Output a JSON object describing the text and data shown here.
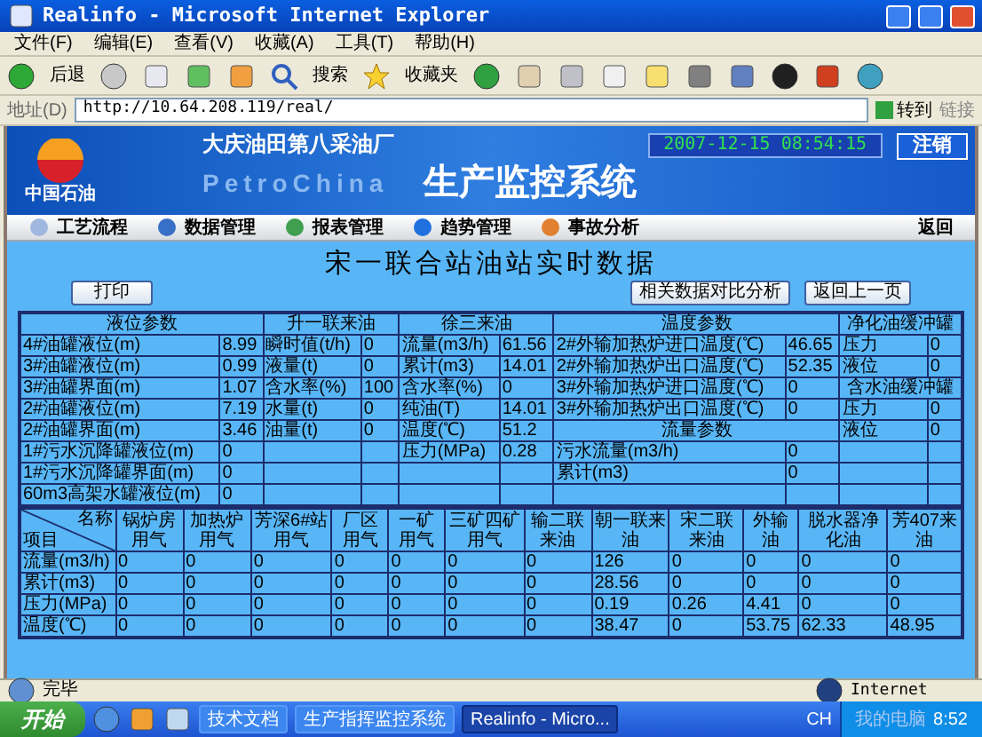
{
  "window": {
    "title": "Realinfo - Microsoft Internet Explorer"
  },
  "menu": [
    "文件(F)",
    "编辑(E)",
    "查看(V)",
    "收藏(A)",
    "工具(T)",
    "帮助(H)"
  ],
  "toolbar": {
    "back": "后退",
    "search": "搜索",
    "favorites": "收藏夹"
  },
  "address": {
    "label": "地址(D)",
    "url": "http://10.64.208.119/real/",
    "go": "转到",
    "links": "链接"
  },
  "banner": {
    "logo_text": "中国石油",
    "company": "大庆油田第八采油厂",
    "brand": "PetroChina",
    "system": "生产监控系统",
    "clock": "2007-12-15 08:54:15",
    "logout": "注销"
  },
  "nav": {
    "items": [
      "工艺流程",
      "数据管理",
      "报表管理",
      "趋势管理",
      "事故分析"
    ],
    "back": "返回"
  },
  "page": {
    "title": "宋一联合站油站实时数据",
    "print": "打印",
    "compare": "相关数据对比分析",
    "back": "返回上一页"
  },
  "top_panel": {
    "groups": [
      {
        "title": "液位参数",
        "entries": [
          {
            "kind": "pair",
            "label": "4#油罐液位(m)",
            "value": "8.99"
          },
          {
            "kind": "pair",
            "label": "3#油罐液位(m)",
            "value": "0.99"
          },
          {
            "kind": "pair",
            "label": "3#油罐界面(m)",
            "value": "1.07"
          },
          {
            "kind": "pair",
            "label": "2#油罐液位(m)",
            "value": "7.19"
          },
          {
            "kind": "pair",
            "label": "2#油罐界面(m)",
            "value": "3.46"
          },
          {
            "kind": "pair",
            "label": "1#污水沉降罐液位(m)",
            "value": "0"
          },
          {
            "kind": "pair",
            "label": "1#污水沉降罐界面(m)",
            "value": "0"
          },
          {
            "kind": "pair",
            "label": "60m3高架水罐液位(m)",
            "value": "0"
          }
        ]
      },
      {
        "title": "升一联来油",
        "entries": [
          {
            "kind": "pair",
            "label": "瞬时值(t/h)",
            "value": "0"
          },
          {
            "kind": "pair",
            "label": "液量(t)",
            "value": "0"
          },
          {
            "kind": "pair",
            "label": "含水率(%)",
            "value": "100"
          },
          {
            "kind": "pair",
            "label": "水量(t)",
            "value": "0"
          },
          {
            "kind": "pair",
            "label": "油量(t)",
            "value": "0"
          }
        ]
      },
      {
        "title": "徐三来油",
        "entries": [
          {
            "kind": "pair",
            "label": "流量(m3/h)",
            "value": "61.56"
          },
          {
            "kind": "pair",
            "label": "累计(m3)",
            "value": "14.01"
          },
          {
            "kind": "pair",
            "label": "含水率(%)",
            "value": "0"
          },
          {
            "kind": "pair",
            "label": "纯油(T)",
            "value": "14.01"
          },
          {
            "kind": "pair",
            "label": "温度(℃)",
            "value": "51.2"
          },
          {
            "kind": "pair",
            "label": "压力(MPa)",
            "value": "0.28"
          }
        ]
      },
      {
        "title": "温度参数",
        "entries": [
          {
            "kind": "pair",
            "label": "2#外输加热炉进口温度(℃)",
            "value": "46.65"
          },
          {
            "kind": "pair",
            "label": "2#外输加热炉出口温度(℃)",
            "value": "52.35"
          },
          {
            "kind": "pair",
            "label": "3#外输加热炉进口温度(℃)",
            "value": "0"
          },
          {
            "kind": "pair",
            "label": "3#外输加热炉出口温度(℃)",
            "value": "0"
          },
          {
            "kind": "subheader",
            "text": "流量参数"
          },
          {
            "kind": "pair",
            "label": "污水流量(m3/h)",
            "value": "0"
          },
          {
            "kind": "pair",
            "label": "累计(m3)",
            "value": "0"
          }
        ]
      },
      {
        "title": "净化油缓冲罐",
        "entries": [
          {
            "kind": "pair",
            "label": "压力",
            "value": "0"
          },
          {
            "kind": "pair",
            "label": "液位",
            "value": "0"
          },
          {
            "kind": "subheader",
            "text": "含水油缓冲罐"
          },
          {
            "kind": "pair",
            "label": "压力",
            "value": "0"
          },
          {
            "kind": "pair",
            "label": "液位",
            "value": "0"
          }
        ]
      }
    ]
  },
  "bottom_table": {
    "corner_top": "名称",
    "corner_bottom": "项目",
    "columns": [
      "锅炉房用气",
      "加热炉用气",
      "芳深6#站用气",
      "厂区用气",
      "一矿用气",
      "三矿四矿用气",
      "输二联来油",
      "朝一联来油",
      "宋二联来油",
      "外输油",
      "脱水器净化油",
      "芳407来油"
    ],
    "rows": [
      {
        "label": "流量(m3/h)",
        "values": [
          "0",
          "0",
          "0",
          "0",
          "0",
          "0",
          "0",
          "126",
          "0",
          "0",
          "0",
          "0"
        ]
      },
      {
        "label": "累计(m3)",
        "values": [
          "0",
          "0",
          "0",
          "0",
          "0",
          "0",
          "0",
          "28.56",
          "0",
          "0",
          "0",
          "0"
        ]
      },
      {
        "label": "压力(MPa)",
        "values": [
          "0",
          "0",
          "0",
          "0",
          "0",
          "0",
          "0",
          "0.19",
          "0.26",
          "4.41",
          "0",
          "0"
        ]
      },
      {
        "label": "温度(℃)",
        "values": [
          "0",
          "0",
          "0",
          "0",
          "0",
          "0",
          "0",
          "38.47",
          "0",
          "53.75",
          "62.33",
          "48.95"
        ]
      }
    ]
  },
  "status_bar": {
    "text": "完毕",
    "zone": "Internet"
  },
  "taskbar": {
    "start": "开始",
    "tasks": [
      {
        "label": "技术文档",
        "selected": false
      },
      {
        "label": "生产指挥监控系统",
        "selected": false
      },
      {
        "label": "Realinfo - Micro...",
        "selected": true
      }
    ],
    "lang": "CH",
    "tray_text": "我的电脑",
    "time": "8:52"
  }
}
